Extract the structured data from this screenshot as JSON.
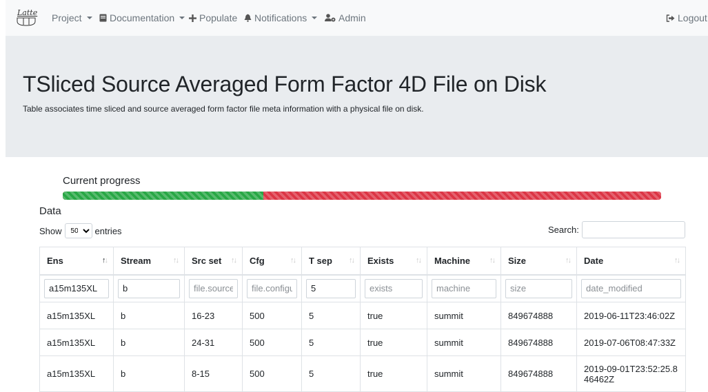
{
  "brand": {
    "text": "Latte"
  },
  "nav": {
    "project": "Project",
    "documentation": "Documentation",
    "populate": "Populate",
    "notifications": "Notifications",
    "admin": "Admin",
    "logout": "Logout"
  },
  "page": {
    "title": "TSliced Source Averaged Form Factor 4D File on Disk",
    "description": "Table associates time sliced and source averaged form factor file meta information with a physical file on disk."
  },
  "progress": {
    "label": "Current progress",
    "completed_fraction": 0.335
  },
  "data_section": {
    "title": "Data",
    "show_label": "Show",
    "entries_value": "50",
    "entries_label": "entries",
    "search_label": "Search:",
    "search_value": ""
  },
  "table": {
    "columns": [
      "Ens",
      "Stream",
      "Src set",
      "Cfg",
      "T sep",
      "Exists",
      "Machine",
      "Size",
      "Date"
    ],
    "sorted_column": "Ens",
    "filters": [
      {
        "value": "a15m135XL",
        "placeholder": ""
      },
      {
        "value": "b",
        "placeholder": ""
      },
      {
        "value": "",
        "placeholder": "file.source_"
      },
      {
        "value": "",
        "placeholder": "file.configu"
      },
      {
        "value": "5",
        "placeholder": ""
      },
      {
        "value": "",
        "placeholder": "exists"
      },
      {
        "value": "",
        "placeholder": "machine"
      },
      {
        "value": "",
        "placeholder": "size"
      },
      {
        "value": "",
        "placeholder": "date_modified"
      }
    ],
    "rows": [
      [
        "a15m135XL",
        "b",
        "16-23",
        "500",
        "5",
        "true",
        "summit",
        "849674888",
        "2019-06-11T23:46:02Z"
      ],
      [
        "a15m135XL",
        "b",
        "24-31",
        "500",
        "5",
        "true",
        "summit",
        "849674888",
        "2019-07-06T08:47:33Z"
      ],
      [
        "a15m135XL",
        "b",
        "8-15",
        "500",
        "5",
        "true",
        "summit",
        "849674888",
        "2019-09-01T23:52:25.846462Z"
      ]
    ]
  },
  "colors": {
    "success": "#28a745",
    "danger": "#dc3545",
    "navbar": "#f8f9fa",
    "jumbotron": "#e9ecef"
  },
  "icons": [
    "book-icon",
    "plus-icon",
    "bell-icon",
    "users-cog-icon",
    "sign-out-icon",
    "sort-icon"
  ]
}
